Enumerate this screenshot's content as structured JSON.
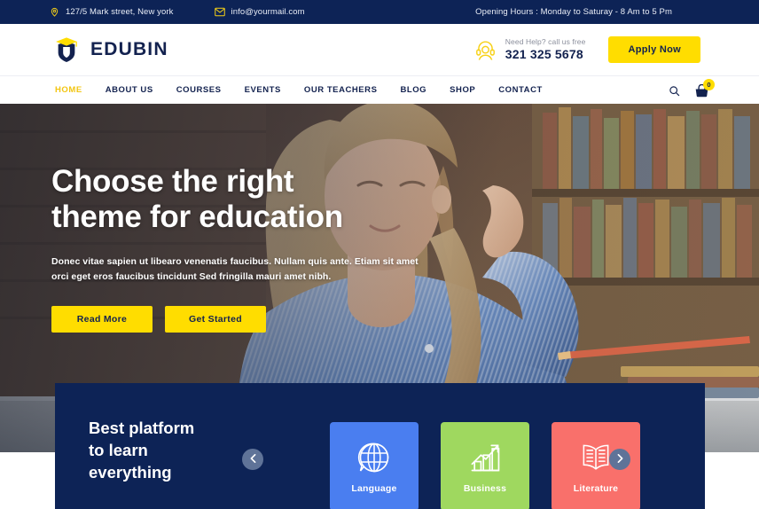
{
  "topbar": {
    "address": "127/5 Mark street, New york",
    "address_icon": "location-pin-icon",
    "email": "info@yourmail.com",
    "email_icon": "envelope-icon",
    "hours": "Opening Hours : Monday to Saturay - 8 Am to 5 Pm",
    "bg_color": "#0d2356",
    "icon_color": "#f7d117"
  },
  "header": {
    "brand_name": "EDUBIN",
    "logo_icon": "graduation-shield-logo",
    "call_icon": "headset-support-icon",
    "call_label": "Need Help? call us free",
    "call_number": "321 325 5678",
    "apply_label": "Apply Now",
    "accent_color": "#ffdd00",
    "navy_color": "#13224f"
  },
  "nav": {
    "items": [
      {
        "label": "HOME",
        "active": true
      },
      {
        "label": "ABOUT US",
        "active": false
      },
      {
        "label": "COURSES",
        "active": false
      },
      {
        "label": "EVENTS",
        "active": false
      },
      {
        "label": "OUR TEACHERS",
        "active": false
      },
      {
        "label": "BLOG",
        "active": false
      },
      {
        "label": "SHOP",
        "active": false
      },
      {
        "label": "CONTACT",
        "active": false
      }
    ],
    "search_icon": "search-icon",
    "cart_icon": "shopping-bag-icon",
    "cart_count": "0",
    "active_color": "#f2c511"
  },
  "hero": {
    "title_line1": "Choose the right",
    "title_line2": "theme for education",
    "subtitle_line1": "Donec vitae sapien ut libearo venenatis faucibus. Nullam quis ante. Etiam sit amet",
    "subtitle_line2": "orci eget eros faucibus tincidunt Sed fringilla mauri amet nibh.",
    "btn_primary": "Read More",
    "btn_secondary": "Get Started"
  },
  "panel": {
    "title_line1": "Best platform",
    "title_line2": "to learn",
    "title_line3": "everything",
    "prev_icon": "chevron-left-icon",
    "next_icon": "chevron-right-icon",
    "bg_color": "#0d2356",
    "cards": [
      {
        "label": "Language",
        "icon": "globe-speech-bubble-icon",
        "color": "#4a7ef0"
      },
      {
        "label": "Business",
        "icon": "bar-chart-growth-icon",
        "color": "#9fd85f"
      },
      {
        "label": "Literature",
        "icon": "open-book-icon",
        "color": "#f9706b"
      }
    ]
  }
}
